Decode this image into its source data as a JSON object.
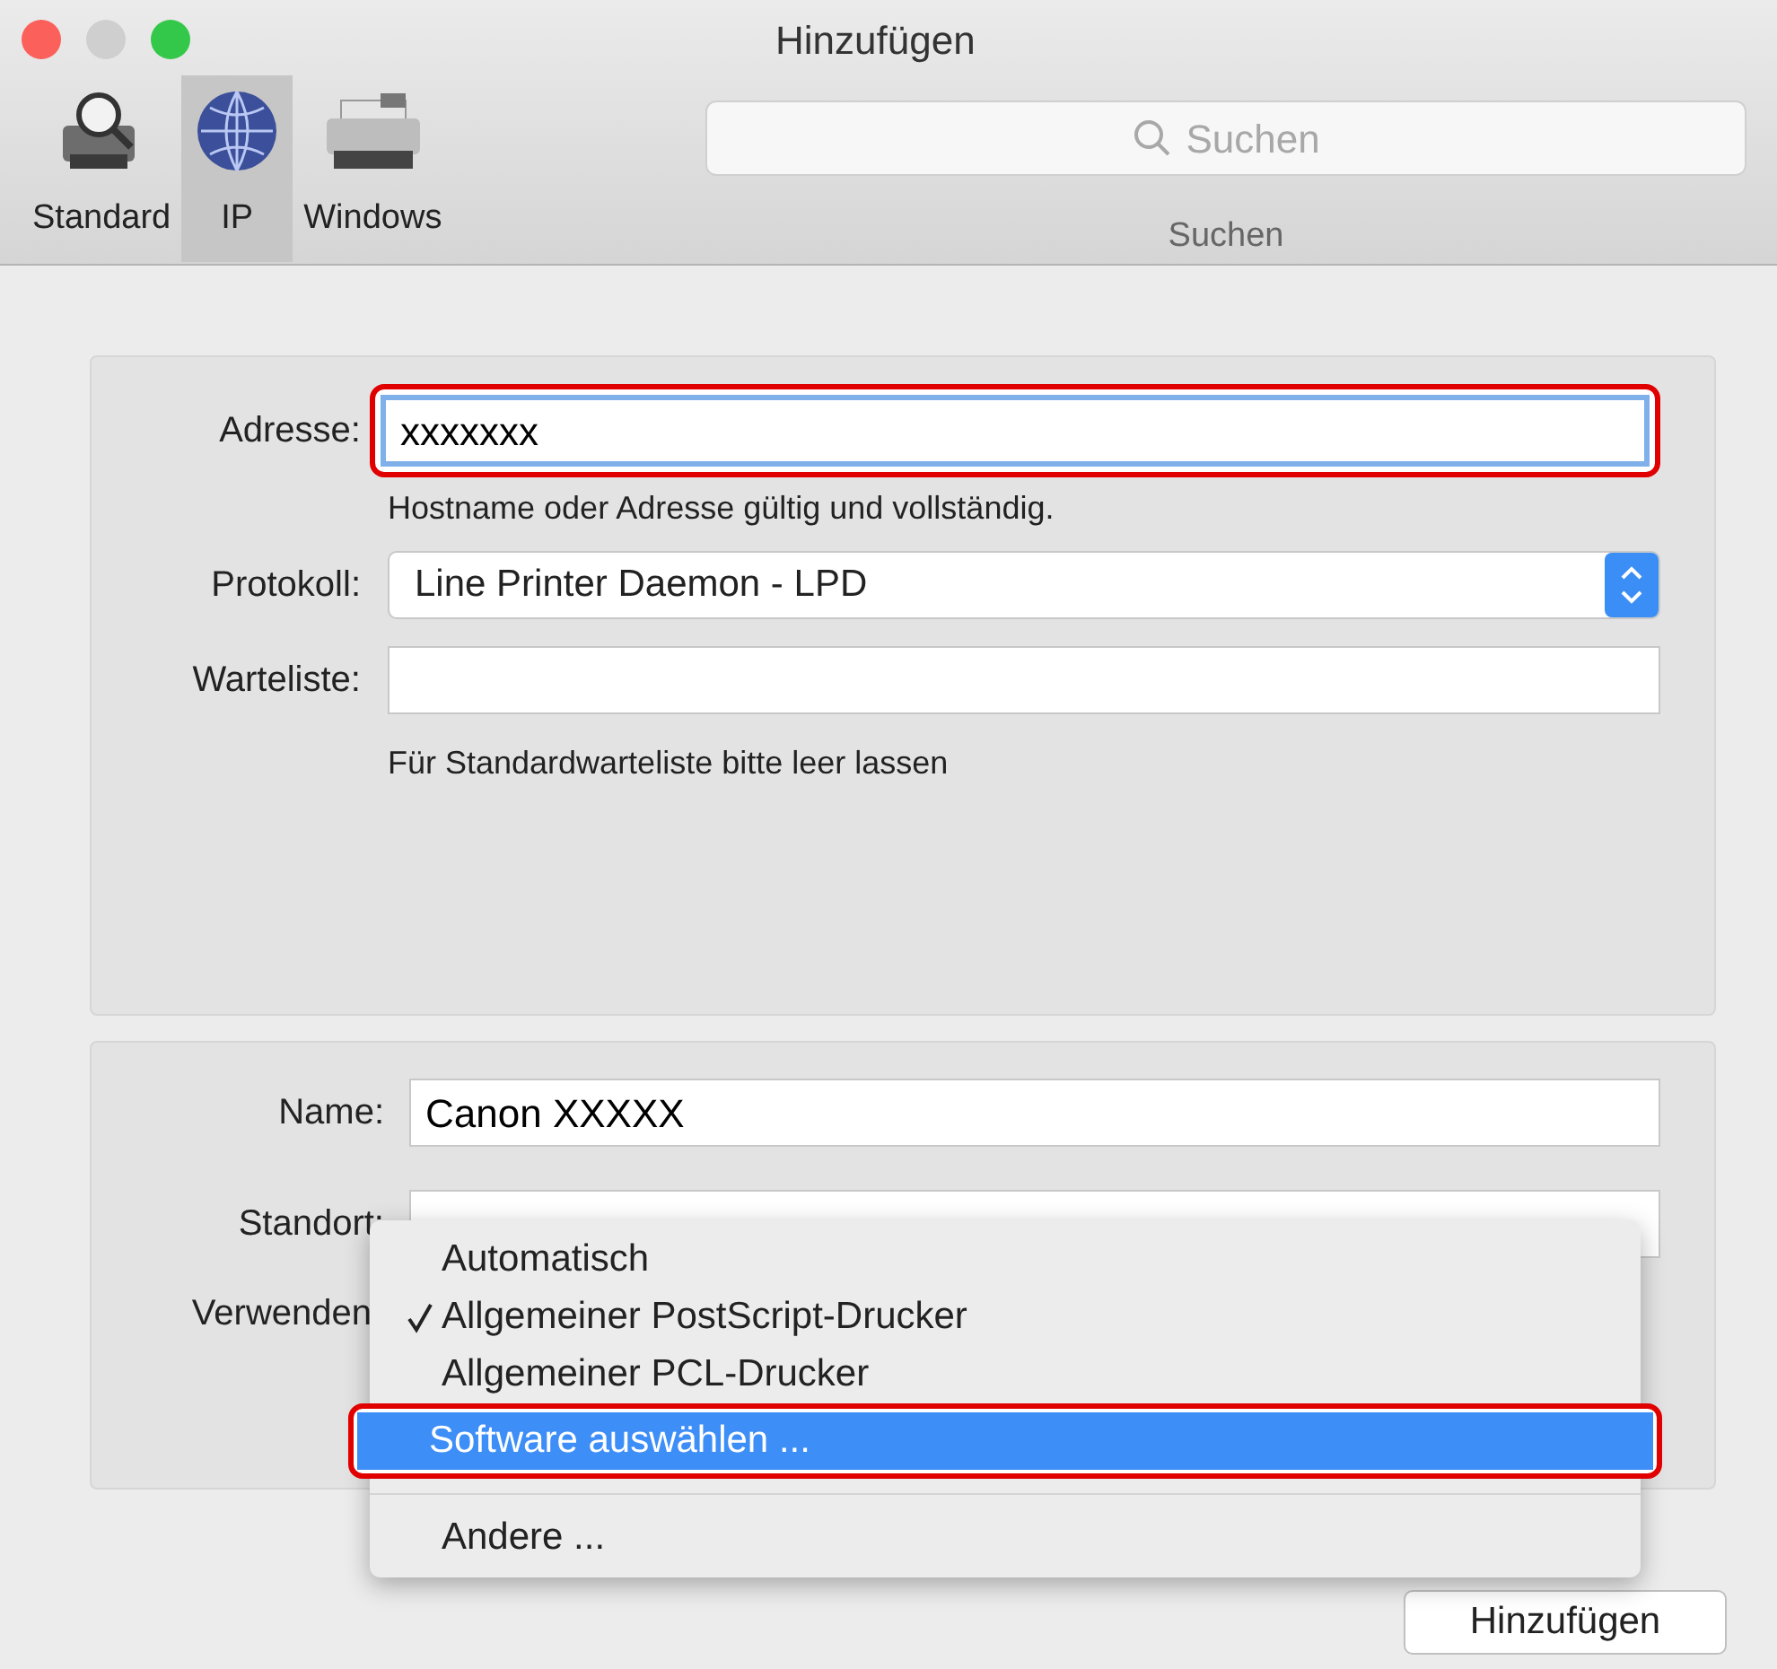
{
  "window": {
    "title": "Hinzufügen"
  },
  "toolbar": {
    "tabs": [
      {
        "label": "Standard",
        "kind": "default",
        "selected": false
      },
      {
        "label": "IP",
        "kind": "ip",
        "selected": true
      },
      {
        "label": "Windows",
        "kind": "windows",
        "selected": false
      }
    ],
    "search": {
      "placeholder": "Suchen",
      "label": "Suchen"
    }
  },
  "address_panel": {
    "address": {
      "label": "Adresse:",
      "value": "xxxxxxx",
      "highlighted": true,
      "hint": "Hostname oder Adresse gültig und vollständig."
    },
    "protocol": {
      "label": "Protokoll:",
      "value": "Line Printer Daemon - LPD"
    },
    "queue": {
      "label": "Warteliste:",
      "hint": "Für Standardwarteliste bitte leer lassen"
    }
  },
  "info_panel": {
    "name": {
      "label": "Name:",
      "value": "Canon XXXXX"
    },
    "location": {
      "label": "Standort:"
    },
    "use": {
      "label": "Verwenden"
    }
  },
  "use_menu": {
    "sections": [
      [
        {
          "label": "Automatisch",
          "checked": false,
          "selected": false,
          "highlighted": false
        },
        {
          "label": "Allgemeiner PostScript-Drucker",
          "checked": true,
          "selected": false,
          "highlighted": false
        },
        {
          "label": "Allgemeiner PCL-Drucker",
          "checked": false,
          "selected": false,
          "highlighted": false
        },
        {
          "label": "Software auswählen ...",
          "checked": false,
          "selected": true,
          "highlighted": true
        }
      ],
      [
        {
          "label": "Andere ...",
          "checked": false,
          "selected": false,
          "highlighted": false
        }
      ]
    ]
  },
  "add_button": "Hinzufügen"
}
